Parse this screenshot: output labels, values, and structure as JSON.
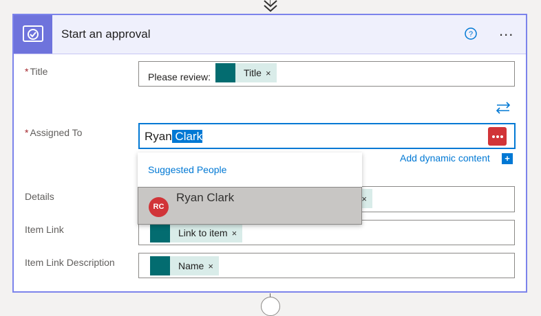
{
  "card": {
    "title": "Start an approval",
    "action_icon": "approval-icon",
    "help_icon": "help-icon",
    "more_label": "..."
  },
  "fields": {
    "title": {
      "label": "Title",
      "required": "*",
      "prefix_text": "Please review:",
      "token": {
        "label": "Title",
        "remove": "×",
        "icon": "sharepoint-icon"
      }
    },
    "assigned_to": {
      "label": "Assigned To",
      "required": "*",
      "value_plain": "Ryan",
      "value_selected": " Clark",
      "swap_icon": "swap-icon",
      "ellipsis_icon": "more-icon"
    },
    "add_dynamic": {
      "label": "Add dynamic content",
      "plus": "+"
    },
    "details": {
      "label": "Details",
      "token_remove": "×"
    },
    "item_link": {
      "label": "Item Link",
      "token": {
        "label": "Link to item",
        "remove": "×",
        "icon": "sharepoint-icon"
      }
    },
    "item_link_description": {
      "label": "Item Link Description",
      "token": {
        "label": "Name",
        "remove": "×",
        "icon": "sharepoint-icon"
      }
    }
  },
  "suggestions": {
    "heading": "Suggested People",
    "items": [
      {
        "initials": "RC",
        "name": "Ryan Clark",
        "avatar_color": "#d13438"
      }
    ]
  },
  "colors": {
    "accent": "#0078d4",
    "card_border": "#7b83eb",
    "header_icon_bg": "#6e73dc",
    "sharepoint": "#036c70",
    "required": "#a4262c"
  }
}
